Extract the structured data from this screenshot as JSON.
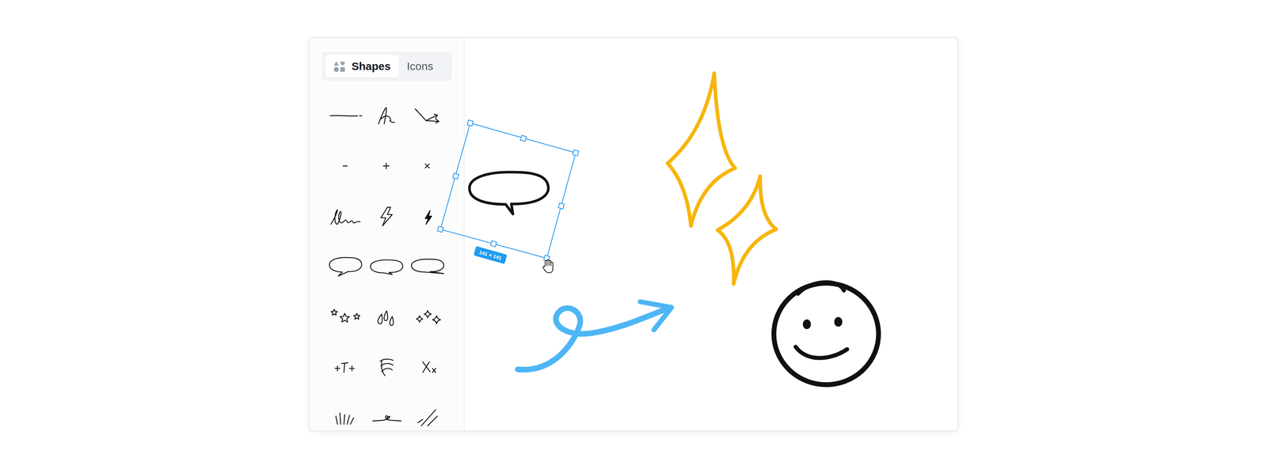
{
  "tabs": [
    {
      "label": "Shapes",
      "selected": true
    },
    {
      "label": "Icons",
      "selected": false
    }
  ],
  "selection": {
    "size": "141 × 141"
  }
}
